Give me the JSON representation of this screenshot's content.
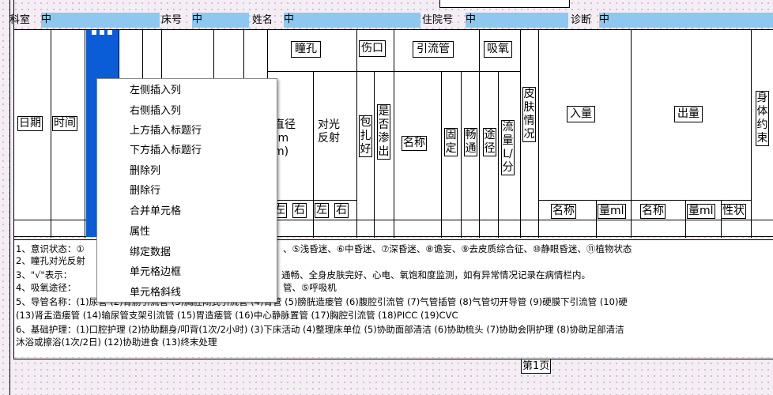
{
  "header": {
    "department_label": "科室",
    "department_value": "中",
    "bed_label": "床号",
    "bed_value": "中",
    "name_label": "姓名",
    "name_value": "中",
    "admission_label": "住院号",
    "admission_value": "中",
    "diagnosis_label": "诊断",
    "diagnosis_value": "中"
  },
  "columns": {
    "date": "日期",
    "time": "时间",
    "pupil": "瞳孔",
    "diameter": "直径(mm)",
    "light_reflex": "对光反射",
    "left": "左",
    "right": "右",
    "wound": "伤口",
    "dressing": "包扎好",
    "oozing": "是否渗出",
    "drainage": "引流管",
    "drain_name": "名称",
    "fixed": "固定",
    "patent": "畅通",
    "oxygen": "吸氧",
    "route": "途径",
    "flow": "流量L/分",
    "skin": "皮肤情况",
    "intake": "入量",
    "output": "出量",
    "name": "名称",
    "amount_ml": "量ml",
    "character": "性状",
    "restraint": "身体约束"
  },
  "legend": {
    "line1_a": "1、意识状态：①",
    "line1_b": "、⑤浅昏迷、⑥中昏迷、⑦深昏迷、⑧谵妄、⑨去皮质综合征、⑩静眼昏迷、⑪植物状态",
    "line2": "2、瞳孔对光反射",
    "line3_a": "3、\"√\"表示：",
    "line3_b": "通畅、全身皮肤完好、心电、氧饱和度监测，如有异常情况记录在病情栏内。",
    "line4_a": "4、吸氧途径：",
    "line4_b": "管、⑤呼吸机",
    "line5": "5、导管名称：(1)尿管 (2)胃肠引流管 (3)胸腔闭式引流管 (4)胃管 (5)膀胱造瘘管 (6)腹腔引流管 (7)气管插管 (8)气管切开导管 (9)硬膜下引流管 (10)硬",
    "line6": "(13)肾盂造瘘管 (14)输尿管支架引流管 (15)胃造瘘管 (16)中心静脉置管 (17)胸腔引流管 (18)PICC (19)CVC",
    "line7": "6、基础护理：(1)口腔护理 (2)协助翻身/叩背(1次/2小时) (3)下床活动 (4)整理床单位 (5)协助面部清洁 (6)协助梳头 (7)协助会阴护理 (8)协助足部清洁",
    "line8": "沐浴或擦浴(1次/2日) (12)协助进食 (13)终末处理"
  },
  "footer": {
    "page_label": "第1页"
  },
  "context_menu": {
    "items": [
      "左侧插入列",
      "右侧插入列",
      "上方插入标题行",
      "下方插入标题行",
      "删除列",
      "删除行",
      "合并单元格",
      "属性",
      "绑定数据",
      "单元格边框",
      "单元格斜线"
    ]
  }
}
